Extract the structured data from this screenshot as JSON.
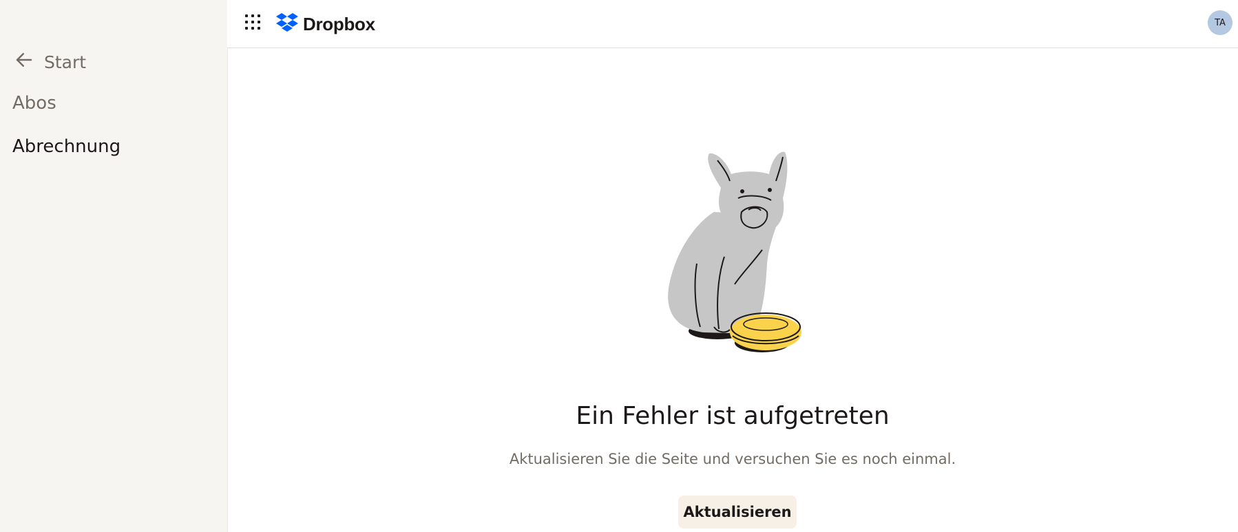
{
  "sidebar": {
    "back_label": "Start",
    "items": [
      {
        "label": "Abos"
      },
      {
        "label": "Abrechnung"
      }
    ]
  },
  "header": {
    "brand": "Dropbox",
    "brand_color": "#0061fe",
    "avatar_initials": "TA",
    "avatar_color": "#b4c8e1"
  },
  "error": {
    "title": "Ein Fehler ist aufgetreten",
    "description": "Aktualisieren Sie die Seite und versuchen Sie es noch einmal.",
    "button_label": "Aktualisieren",
    "illustration": "dog-with-empty-bowl"
  }
}
